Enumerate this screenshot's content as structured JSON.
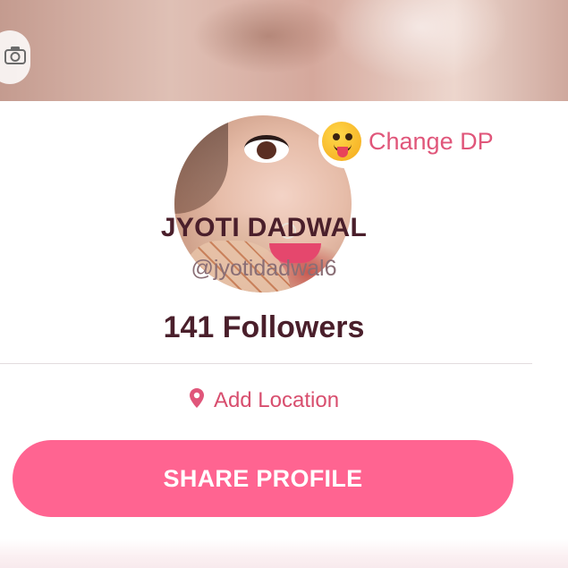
{
  "profile": {
    "change_dp_label": "Change DP",
    "name": "JYOTI DADWAL",
    "handle": "@jyotidadwal6",
    "followers_text": "141 Followers",
    "add_location_label": "Add Location",
    "share_button_label": "SHARE PROFILE"
  },
  "icons": {
    "cover_camera": "camera-icon",
    "change_dp_emoji": "tongue-out-emoji-icon",
    "location": "location-pin-icon"
  },
  "colors": {
    "accent_pink": "#ff6491",
    "link_pink": "#e0567a",
    "name_text": "#4a1f2b",
    "handle_text": "#8a6e75"
  }
}
